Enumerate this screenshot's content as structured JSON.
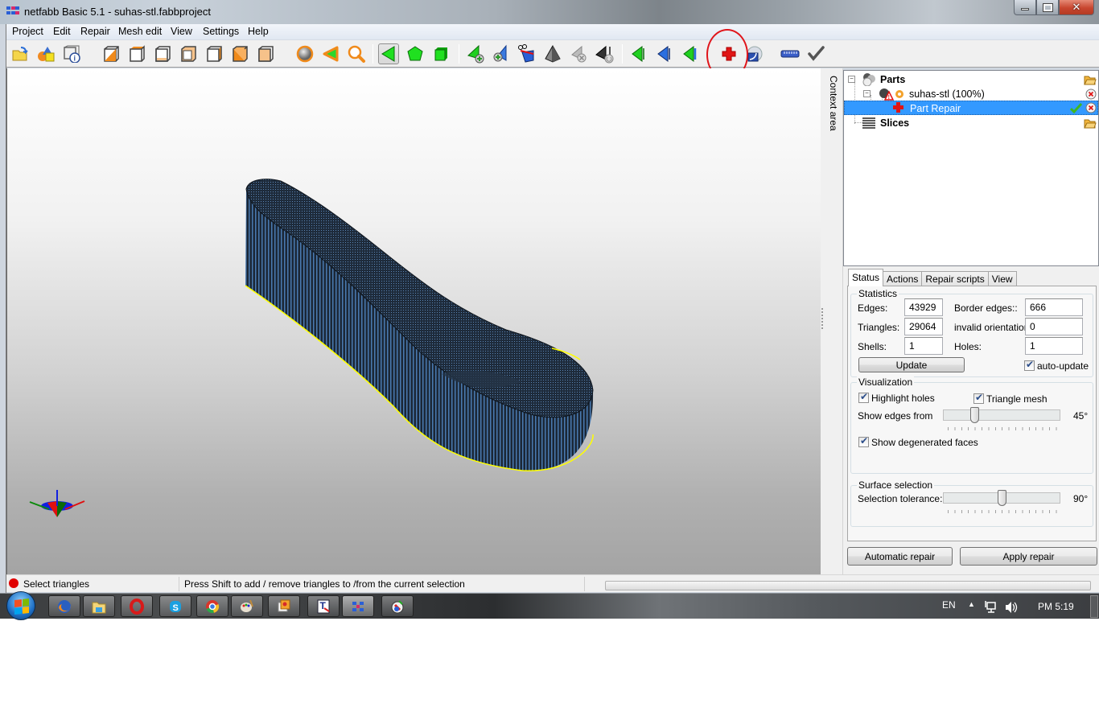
{
  "window": {
    "title": "netfabb Basic 5.1 - suhas-stl.fabbproject",
    "controls": {
      "minimize": "minimize",
      "maximize": "maximize",
      "close": "close"
    }
  },
  "menu": [
    "Project",
    "Edit",
    "Repair",
    "Mesh edit",
    "View",
    "Settings",
    "Help"
  ],
  "toolbar": {
    "buttons": [
      {
        "icon": "open-project-icon"
      },
      {
        "icon": "add-part-icon"
      },
      {
        "icon": "part-info-icon"
      },
      {
        "icon": "view-front-icon"
      },
      {
        "icon": "view-back-icon"
      },
      {
        "icon": "view-bottom-icon"
      },
      {
        "icon": "view-top-icon"
      },
      {
        "icon": "view-left-icon"
      },
      {
        "icon": "view-right-icon"
      },
      {
        "icon": "view-iso-icon"
      },
      {
        "icon": "shading-sphere-icon"
      },
      {
        "icon": "select-orange-triangle-icon"
      },
      {
        "icon": "zoom-icon"
      },
      {
        "icon": "select-triangles-icon",
        "active": true
      },
      {
        "icon": "select-surface-icon"
      },
      {
        "icon": "select-shell-icon"
      },
      {
        "icon": "add-triangle-icon"
      },
      {
        "icon": "add-point-icon"
      },
      {
        "icon": "cut-triangles-icon"
      },
      {
        "icon": "pyramid-icon"
      },
      {
        "icon": "remove-triangles-icon"
      },
      {
        "icon": "remove-shells-icon"
      },
      {
        "icon": "flip-green-icon"
      },
      {
        "icon": "flip-blue-icon"
      },
      {
        "icon": "flip-green-blue-icon"
      },
      {
        "icon": "repair-cross-icon",
        "highlighted": true
      },
      {
        "icon": "measure-dropdown-icon"
      },
      {
        "icon": "ruler-icon"
      },
      {
        "icon": "checkmark-icon"
      }
    ]
  },
  "context_area_label": "Context area",
  "tree": {
    "parts_label": "Parts",
    "part_name": "suhas-stl (100%)",
    "repair_label": "Part Repair",
    "slices_label": "Slices"
  },
  "props": {
    "tabs": [
      {
        "label": "Status",
        "active": true
      },
      {
        "label": "Actions"
      },
      {
        "label": "Repair scripts"
      },
      {
        "label": "View"
      }
    ],
    "statistics": {
      "title": "Statistics",
      "edges_label": "Edges:",
      "edges": "43929",
      "triangles_label": "Triangles:",
      "triangles": "29064",
      "shells_label": "Shells:",
      "shells": "1",
      "border_edges_label": "Border edges::",
      "border_edges": "666",
      "invalid_orientation_label": "invalid orientation:",
      "invalid_orientation": "0",
      "holes_label": "Holes:",
      "holes": "1",
      "update_button": "Update",
      "auto_update_label": "auto-update",
      "auto_update": true
    },
    "visualization": {
      "title": "Visualization",
      "highlight_holes_label": "Highlight holes",
      "highlight_holes": true,
      "triangle_mesh_label": "Triangle mesh",
      "triangle_mesh": true,
      "show_edges_label": "Show edges from",
      "show_edges_value": "45°",
      "show_edges_fraction": 0.25,
      "degenerated_label": "Show degenerated faces",
      "degenerated": true
    },
    "surface_selection": {
      "title": "Surface selection",
      "tolerance_label": "Selection tolerance:",
      "tolerance_value": "90°",
      "tolerance_fraction": 0.5
    },
    "automatic_repair_button": "Automatic repair",
    "apply_repair_button": "Apply repair"
  },
  "statusbar": {
    "mode": "Select triangles",
    "hint": "Press Shift to add / remove triangles to /from the current selection"
  },
  "taskbar": {
    "apps": [
      "firefox",
      "file-explorer",
      "opera",
      "skype",
      "chrome",
      "paint",
      "image-viewer",
      "text-editor",
      "netfabb",
      "graphics-app"
    ],
    "language": "EN",
    "clock": "PM 5:19"
  },
  "colors": {
    "selection": "#3399ff",
    "hole_outline": "#ffff00",
    "mesh": "#1c2a3a",
    "highlight_circle": "#e0151b"
  }
}
